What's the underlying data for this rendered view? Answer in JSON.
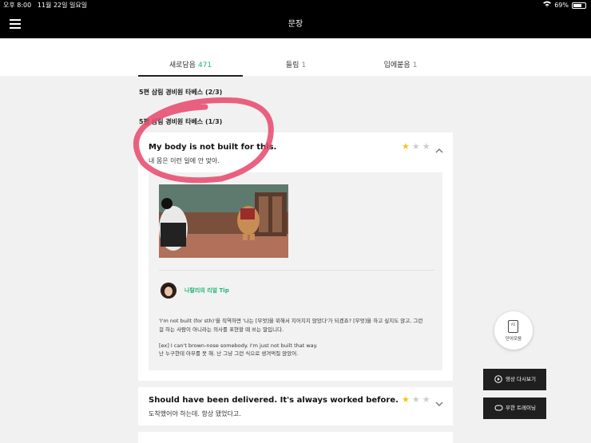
{
  "status_bar": {
    "time": "오후 8:00",
    "date": "11월 22일 일요일",
    "battery": "69%",
    "battery_level": 0.69
  },
  "header": {
    "title": "문장"
  },
  "tabs": [
    {
      "label": "새로담음",
      "count": "471"
    },
    {
      "label": "들림",
      "count": "1"
    },
    {
      "label": "입에붙음",
      "count": "1"
    }
  ],
  "sections": [
    {
      "title": "5편 삼림 경비원 타베스 (2/3)"
    },
    {
      "title": "5편 삼림 경비원 타베스 (1/3)"
    }
  ],
  "cards": [
    {
      "english": "My body is not built for this.",
      "korean": "내 몸은 이런 일에 안 맞아.",
      "rating": 1,
      "tip_author": "나탈리의 리얼 Tip",
      "tip_line1": "'I'm not built (for sth)'을 직역하면 '나는 [무엇]을 위해서 지어지지 않았다'가 되겠죠? [무엇]을 하고 싶지도 않고, 그런",
      "tip_line2": "걸 하는 사람이 아니라는 의사를 표현할 때 쓰는 말입니다.",
      "example_en": "[ex] I can't brown-nose somebody. I'm just not built that way.",
      "example_ko": "난 누구한테 아부를 못 해. 난 그냥 그런 식으로 생겨먹질 않았어."
    },
    {
      "english": "Should have been delivered. It's always worked before.",
      "korean": "도착했어야 하는데. 항상 됐었다고.",
      "rating": 1
    }
  ],
  "floating": {
    "word_collection": "단어모음",
    "word_icon_text": "A5",
    "replay_video": "영상 다시보기",
    "infinite_training": "무한 트레이닝"
  },
  "colors": {
    "accent": "#22b573",
    "star": "#f6c319",
    "highlight": "#e8476b"
  }
}
